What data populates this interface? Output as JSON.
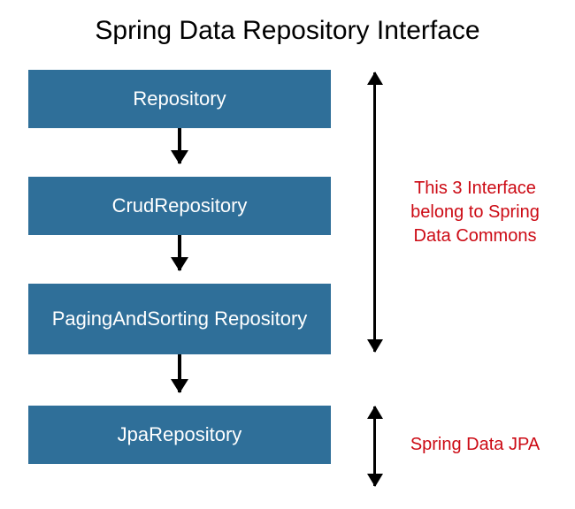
{
  "title": "Spring Data Repository Interface",
  "boxes": [
    {
      "label": "Repository"
    },
    {
      "label": "CrudRepository"
    },
    {
      "label": "PagingAndSorting Repository"
    },
    {
      "label": "JpaRepository"
    }
  ],
  "annotations": [
    {
      "text": "This 3 Interface belong to Spring Data Commons"
    },
    {
      "text": "Spring Data JPA"
    }
  ],
  "colors": {
    "box_fill": "#2f6f99",
    "box_text": "#ffffff",
    "annotation_text": "#cc0a14"
  }
}
